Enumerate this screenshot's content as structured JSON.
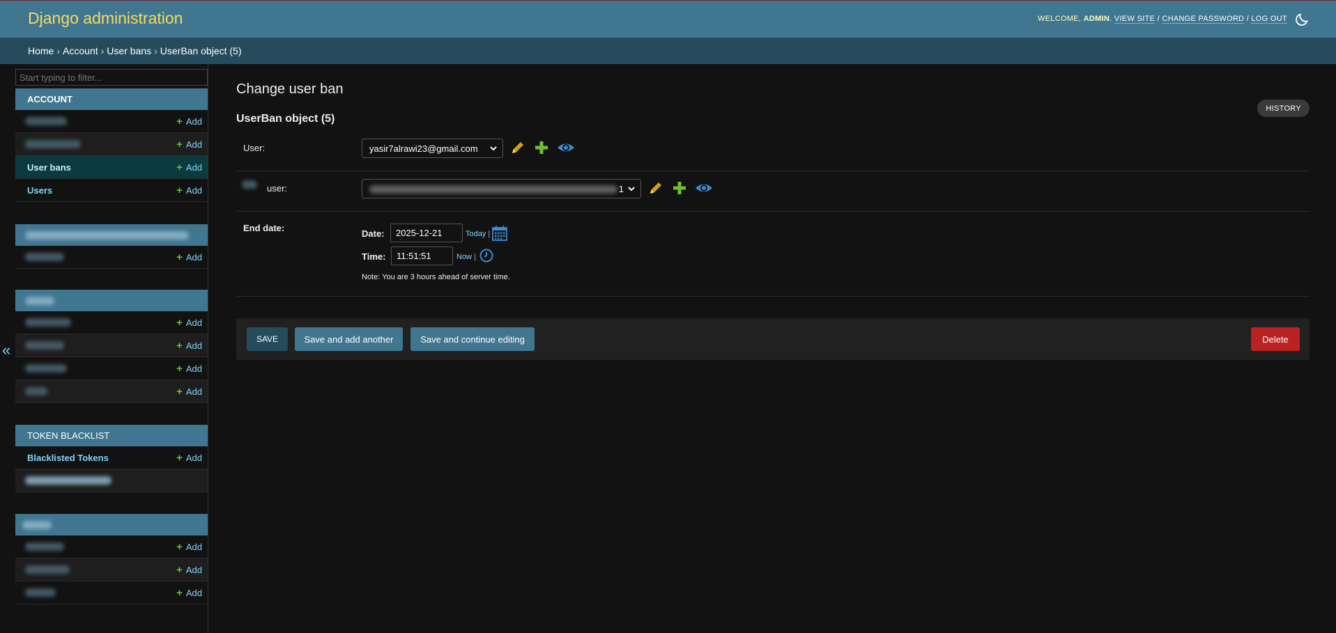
{
  "header": {
    "brand": "Django administration",
    "welcome": "WELCOME, ",
    "username": "ADMIN",
    "view_site": "VIEW SITE",
    "change_password": "CHANGE PASSWORD",
    "log_out": "LOG OUT",
    "separator": " / "
  },
  "breadcrumbs": {
    "home": "Home",
    "account": "Account",
    "user_bans": "User bans",
    "current": "UserBan object (5)",
    "sep": "›"
  },
  "sidebar": {
    "filter_placeholder": "Start typing to filter...",
    "collapse": "«",
    "add_label": "Add",
    "modules": {
      "account": "ACCOUNT",
      "token_blacklist": "TOKEN BLACKLIST"
    },
    "items": {
      "user_bans": "User bans",
      "users": "Users",
      "blacklisted_tokens": "Blacklisted Tokens"
    }
  },
  "main": {
    "title": "Change user ban",
    "object_title": "UserBan object (5)",
    "history": "HISTORY",
    "user_label": "User:",
    "user_value": "yasir7alrawi23@gmail.com",
    "second_user_label_suffix": "user:",
    "end_date_label": "End date:",
    "date_label": "Date:",
    "date_value": "2025-12-21",
    "today": "Today",
    "time_label": "Time:",
    "time_value": "11:51:51",
    "now": "Now",
    "pipe": " |",
    "second_select_tail": "1",
    "note": "Note: You are 3 hours ahead of server time."
  },
  "buttons": {
    "save": "SAVE",
    "save_add": "Save and add another",
    "save_continue": "Save and continue editing",
    "delete": "Delete"
  },
  "colors": {
    "header": "#417690",
    "breadcrumbs": "#264b5d",
    "brand": "#f5dd5d",
    "link": "#81d4fa",
    "add_plus": "#70bf2b",
    "delete": "#ba2121",
    "background": "#121212"
  },
  "icons": {
    "theme_toggle": "moon-icon",
    "edit": "pencil-icon",
    "add": "plus-icon",
    "view": "eye-icon",
    "calendar": "calendar-icon",
    "clock": "clock-icon"
  }
}
